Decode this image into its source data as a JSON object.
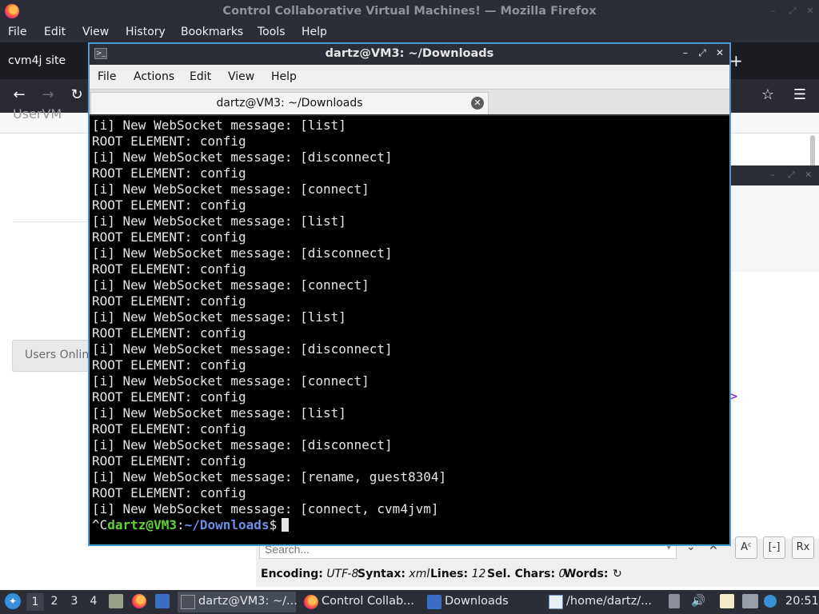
{
  "firefox": {
    "title": "Control Collaborative Virtual Machines! — Mozilla Firefox",
    "menu": [
      "File",
      "Edit",
      "View",
      "History",
      "Bookmarks",
      "Tools",
      "Help"
    ],
    "tab_label": "cvm4j site",
    "newtab_icon": "+",
    "content": {
      "userlist_label": "UserVM",
      "users_online_button": "Users Online"
    }
  },
  "terminal": {
    "title": "dartz@VM3: ~/Downloads",
    "menu": [
      "File",
      "Actions",
      "Edit",
      "View",
      "Help"
    ],
    "tab_label": "dartz@VM3: ~/Downloads",
    "lines": [
      "[i] New WebSocket message: [list]",
      "ROOT ELEMENT: config",
      "[i] New WebSocket message: [disconnect]",
      "ROOT ELEMENT: config",
      "[i] New WebSocket message: [connect]",
      "ROOT ELEMENT: config",
      "[i] New WebSocket message: [list]",
      "ROOT ELEMENT: config",
      "[i] New WebSocket message: [disconnect]",
      "ROOT ELEMENT: config",
      "[i] New WebSocket message: [connect]",
      "ROOT ELEMENT: config",
      "[i] New WebSocket message: [list]",
      "ROOT ELEMENT: config",
      "[i] New WebSocket message: [disconnect]",
      "ROOT ELEMENT: config",
      "[i] New WebSocket message: [connect]",
      "ROOT ELEMENT: config",
      "[i] New WebSocket message: [list]",
      "ROOT ELEMENT: config",
      "[i] New WebSocket message: [disconnect]",
      "ROOT ELEMENT: config",
      "[i] New WebSocket message: [rename, guest8304]",
      "ROOT ELEMENT: config",
      "[i] New WebSocket message: [connect, cvm4jvm]"
    ],
    "prompt": {
      "prefix": "^C",
      "user_host": "dartz@VM3",
      "sep": ":",
      "path": "~/Downloads",
      "symbol": "$"
    }
  },
  "editor": {
    "search_placeholder": "Search...",
    "opt_case": "Aᶜ",
    "opt_word": "[-]",
    "opt_regex": "Rx",
    "status": {
      "encoding_label": "Encoding:",
      "encoding_value": "UTF-8",
      "syntax_label": "Syntax:",
      "syntax_value": "xml",
      "lines_label": "Lines:",
      "lines_value": "12",
      "selchars_label": "Sel. Chars:",
      "selchars_value": "0",
      "words_label": "Words:"
    },
    "arrow_glyph": ">"
  },
  "taskbar": {
    "workspaces": [
      "1",
      "2",
      "3",
      "4"
    ],
    "active_workspace": "1",
    "tasks": [
      {
        "label": "dartz@VM3: ~/...",
        "icon": "terminal-icon"
      },
      {
        "label": "Control Collab...",
        "icon": "firefox-icon"
      },
      {
        "label": "Downloads",
        "icon": "folder-icon"
      },
      {
        "label": "/home/dartz/...",
        "icon": "text-editor-icon"
      }
    ],
    "clock": "20:51"
  }
}
